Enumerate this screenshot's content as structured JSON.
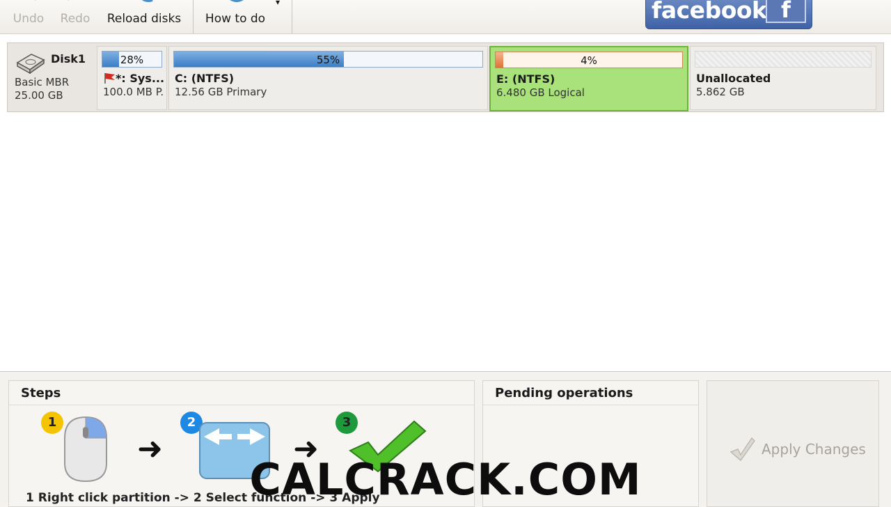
{
  "toolbar": {
    "undo_label": "Undo",
    "redo_label": "Redo",
    "reload_label": "Reload disks",
    "howto_label": "How to do",
    "facebook_text": "facebook",
    "facebook_f": "f"
  },
  "disk": {
    "name": "Disk1",
    "type": "Basic MBR",
    "size": "25.00 GB",
    "partitions": [
      {
        "percent_label": "28%",
        "used": 0.28,
        "name": "*: Sys...",
        "detail": "100.0 MB P."
      },
      {
        "percent_label": "55%",
        "used": 0.55,
        "name": "C: (NTFS)",
        "detail": "12.56 GB Primary"
      },
      {
        "percent_label": "4%",
        "used": 0.04,
        "name": "E: (NTFS)",
        "detail": "6.480 GB Logical",
        "selected": true
      },
      {
        "percent_label": "",
        "used": 0,
        "name": "Unallocated",
        "detail": "5.862 GB"
      }
    ]
  },
  "steps": {
    "title": "Steps",
    "badges": [
      "1",
      "2",
      "3"
    ],
    "caption": "1 Right click partition -> 2 Select function -> 3 Apply"
  },
  "pending": {
    "title": "Pending operations"
  },
  "apply": {
    "label": "Apply Changes"
  },
  "watermark": "CALCRACK.COM",
  "colors": {
    "accent_blue": "#3b7ec7",
    "selected_green": "#a9e27a",
    "facebook_blue": "#3f62a6",
    "badge_yellow": "#f5c400",
    "badge_blue": "#1e88e5",
    "badge_green": "#1e9a3c"
  }
}
